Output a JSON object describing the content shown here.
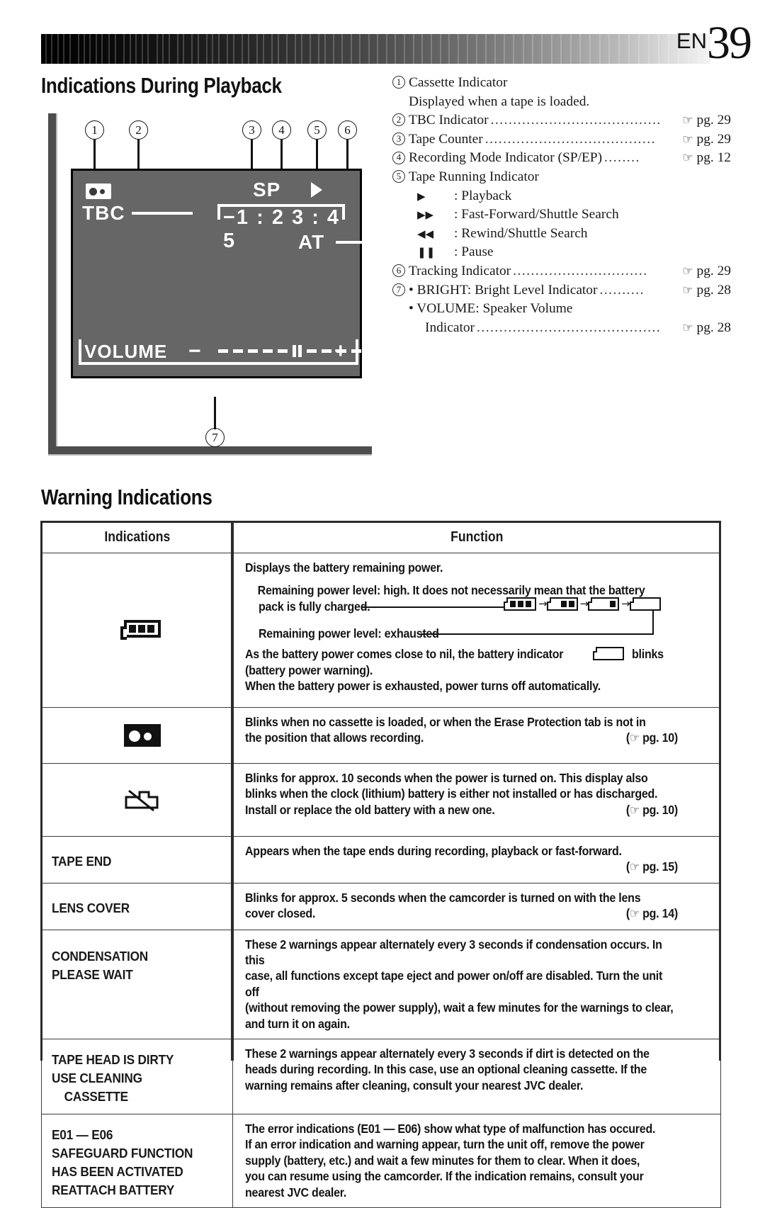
{
  "header": {
    "lang_code": "EN",
    "page_number": "39"
  },
  "sections": {
    "playback_title": "Indications During Playback",
    "warning_title": "Warning Indications"
  },
  "diagram": {
    "callouts": [
      "1",
      "2",
      "3",
      "4",
      "5",
      "6",
      "7"
    ],
    "osd": {
      "cassette_icon": "cassette-icon",
      "tbc": "TBC",
      "recording_mode": "SP",
      "play_icon": "play-triangle-icon",
      "counter": "−1 : 2 3 : 4 5",
      "tracking": "AT",
      "volume_label": "VOLUME",
      "volume_minus": "−",
      "volume_plus": "+"
    }
  },
  "legend": [
    {
      "num": "1",
      "text": "Cassette Indicator",
      "sub": "Displayed when a tape is loaded.",
      "page": ""
    },
    {
      "num": "2",
      "text": "TBC Indicator",
      "page": "pg. 29"
    },
    {
      "num": "3",
      "text": "Tape Counter",
      "page": "pg. 29"
    },
    {
      "num": "4",
      "text": "Recording Mode Indicator (SP/EP)",
      "page": "pg. 12"
    },
    {
      "num": "5",
      "text": "Tape Running Indicator",
      "page": ""
    },
    {
      "num": "6",
      "text": "Tracking Indicator",
      "page": "pg. 29"
    },
    {
      "num": "7",
      "text": "• BRIGHT: Bright Level Indicator",
      "page": "pg. 28"
    }
  ],
  "tape_running": [
    {
      "symbol": "▶",
      "label": ": Playback"
    },
    {
      "symbol": "▶▶",
      "label": ": Fast-Forward/Shuttle Search"
    },
    {
      "symbol": "◀◀",
      "label": ": Rewind/Shuttle Search"
    },
    {
      "symbol": "❚❚",
      "label": ": Pause"
    }
  ],
  "volume_entry": {
    "line1": "• VOLUME: Speaker Volume",
    "line2": "Indicator",
    "page": "pg. 28"
  },
  "table": {
    "headers": {
      "indications": "Indications",
      "function": "Function"
    },
    "rows": [
      {
        "indication_type": "battery-icon",
        "indication_labels": [],
        "function_lines": [
          "Displays the battery remaining power.",
          "Remaining power level: high. It does not necessarily mean that the battery",
          "pack is fully charged.",
          "Remaining power level: exhausted",
          "As the battery power comes close to nil, the battery indicator",
          "blinks",
          "(battery power warning).",
          "When the battery power is exhausted, power turns off automatically."
        ],
        "page": ""
      },
      {
        "indication_type": "cassette-icon",
        "indication_labels": [],
        "function_lines": [
          "Blinks when no cassette is loaded, or when the Erase Protection tab is not in",
          "the position that allows recording."
        ],
        "page": "pg. 10"
      },
      {
        "indication_type": "lithium-battery-slash-icon",
        "indication_labels": [],
        "function_lines": [
          "Blinks for approx. 10 seconds when the power is turned on. This display also",
          "blinks when the clock (lithium) battery is either not installed or has discharged.",
          "Install or replace the old battery with a new one."
        ],
        "page": "pg. 10"
      },
      {
        "indication_type": "text",
        "indication_labels": [
          "TAPE END"
        ],
        "function_lines": [
          "Appears when the tape ends during recording, playback or fast-forward."
        ],
        "page": "pg. 15"
      },
      {
        "indication_type": "text",
        "indication_labels": [
          "LENS COVER"
        ],
        "function_lines": [
          "Blinks for approx. 5 seconds when the camcorder is turned on with the lens",
          "cover closed."
        ],
        "page": "pg. 14"
      },
      {
        "indication_type": "text",
        "indication_labels": [
          "CONDENSATION",
          "PLEASE WAIT"
        ],
        "function_lines": [
          "These 2 warnings appear alternately every 3 seconds if condensation occurs. In this",
          "case, all functions except tape eject and power on/off are disabled. Turn the unit off",
          "(without removing the power supply), wait a few minutes for the warnings to clear,",
          "and turn it on again."
        ],
        "page": ""
      },
      {
        "indication_type": "text",
        "indication_labels": [
          "TAPE HEAD IS DIRTY",
          "USE CLEANING",
          "CASSETTE"
        ],
        "function_lines": [
          "These 2 warnings appear alternately every 3 seconds if dirt is detected on the",
          "heads during recording. In this case, use an optional cleaning cassette. If the",
          "warning remains after cleaning, consult your nearest JVC dealer."
        ],
        "page": ""
      },
      {
        "indication_type": "text",
        "indication_labels": [
          "E01 — E06",
          "SAFEGUARD FUNCTION",
          "HAS BEEN ACTIVATED",
          "REATTACH BATTERY"
        ],
        "function_lines": [
          "The error indications (E01 — E06) show what type of malfunction has occured.",
          "If an error indication and warning appear, turn the unit off, remove the power",
          "supply (battery, etc.) and wait a few minutes for them to clear. When it does,",
          "you can resume using the camcorder. If the indication remains, consult your",
          "nearest JVC dealer."
        ],
        "page": ""
      }
    ]
  },
  "colors": {
    "screen_gray": "#666666",
    "bracket_gray": "#4d4d4d",
    "rule": "#3b3b3b"
  }
}
